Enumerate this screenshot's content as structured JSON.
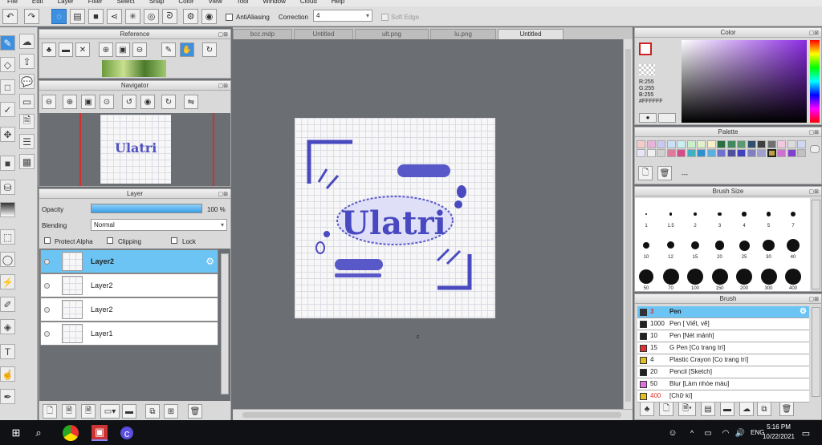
{
  "menu": [
    "File",
    "Edit",
    "Layer",
    "Filter",
    "Select",
    "Snap",
    "Color",
    "View",
    "Tool",
    "Window",
    "Cloud",
    "Help"
  ],
  "toolbar": {
    "antialias_label": "AntiAliasing",
    "correction_label": "Correction",
    "correction_value": "4",
    "soft_edge_label": "Soft Edge"
  },
  "reference": {
    "title": "Reference"
  },
  "navigator": {
    "title": "Navigator"
  },
  "layer_panel": {
    "title": "Layer",
    "opacity_label": "Opacity",
    "opacity_value": "100 %",
    "opacity_fraction": 1.0,
    "blending_label": "Blending",
    "blending_value": "Normal",
    "protect_alpha_label": "Protect Alpha",
    "clipping_label": "Clipping",
    "lock_label": "Lock",
    "layers": [
      {
        "name": "Layer2",
        "selected": true
      },
      {
        "name": "Layer2",
        "selected": false
      },
      {
        "name": "Layer2",
        "selected": false
      },
      {
        "name": "Layer1",
        "selected": false
      }
    ]
  },
  "tabs": [
    "bcc.mdp",
    "Untitled",
    "ult.png",
    "lu.png",
    "Untitled"
  ],
  "canvas": {
    "artwork_text": "Ulatri"
  },
  "color_panel": {
    "title": "Color",
    "r": "R:255",
    "g": "G:255",
    "b": "B:255",
    "hex": "#FFFFFF"
  },
  "palette": {
    "title": "Palette",
    "colors": [
      "#f7c9c9",
      "#e8b3d9",
      "#c9c9f0",
      "#c9e0f7",
      "#c9f0f0",
      "#c9f0c9",
      "#e0f0c9",
      "#f7f0c9",
      "#2a6f3f",
      "#3f8a5a",
      "#5a9a6f",
      "#2f4f6f",
      "#3f3f3f",
      "#6f6f6f",
      "#f0c9e0",
      "#dcdcdc",
      "#cfd8f0",
      "#e6e6f7",
      "#f0f0f0",
      "#d0d0d0",
      "#e07a9a",
      "#d44a8a",
      "#3fb0c0",
      "#2f90d0",
      "#5ab0e0",
      "#7070d0",
      "#5050a0",
      "#4040c0",
      "#8080c0",
      "#a0a0d0",
      "#c0a040",
      "#d070d0",
      "#8040d0",
      "#c0c0c0"
    ],
    "selected_index": 30,
    "more_label": "---"
  },
  "brush_size": {
    "title": "Brush Size",
    "rows": [
      [
        "1",
        "1.5",
        "2",
        "3",
        "4",
        "5",
        "7"
      ],
      [
        "10",
        "12",
        "15",
        "20",
        "25",
        "30",
        "40"
      ],
      [
        "50",
        "70",
        "100",
        "150",
        "200",
        "300",
        "400"
      ]
    ]
  },
  "brush_list": {
    "title": "Brush",
    "items": [
      {
        "size": "3",
        "name": "Pen",
        "color": "#333333",
        "selected": true
      },
      {
        "size": "1000",
        "name": "Pen [ Viết, vẽ]",
        "color": "#222222",
        "selected": false
      },
      {
        "size": "10",
        "name": "Pen [Nét mảnh]",
        "color": "#222222",
        "selected": false
      },
      {
        "size": "15",
        "name": "G Pen [Cọ trang trí]",
        "color": "#e03030",
        "selected": false
      },
      {
        "size": "4",
        "name": "Plastic Crayon [Cọ trang trí]",
        "color": "#e0c020",
        "selected": false
      },
      {
        "size": "20",
        "name": "Pencil [Sketch]",
        "color": "#222222",
        "selected": false
      },
      {
        "size": "50",
        "name": "Blur [Làm nhòe màu]",
        "color": "#e070e0",
        "selected": false
      },
      {
        "size": "400",
        "name": "[Chữ kí]",
        "color": "#e0c020",
        "selected": false
      }
    ]
  },
  "taskbar": {
    "language": "ENG",
    "time": "5:16 PM",
    "date": "10/22/2021"
  }
}
